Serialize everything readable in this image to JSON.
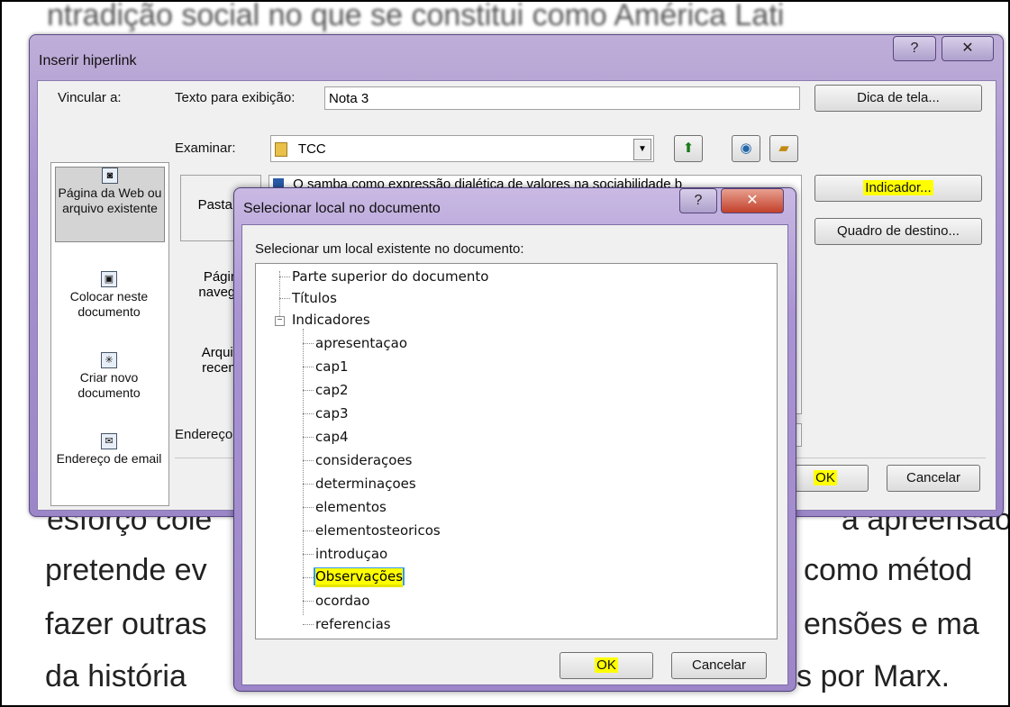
{
  "background_document": {
    "lines": [
      "pretende ev",
      "como métod",
      "fazer outras",
      "ensões e ma",
      "da história",
      "s por Marx.",
      "esforço cole",
      "a apreensão"
    ]
  },
  "hyperlink_dialog": {
    "title": "Inserir hiperlink",
    "help_btn": "?",
    "close_btn": "✕",
    "link_to_label": "Vincular a:",
    "display_text_label": "Texto para exibição:",
    "display_text_value": "Nota 3",
    "screen_tip_btn": "Dica de tela...",
    "browse_label": "Examinar:",
    "browse_value": "TCC",
    "file_list_first": "O samba como expressão dialética de valores na sociabilidade b",
    "bookmark_btn": "Indicador...",
    "target_frame_btn": "Quadro de destino...",
    "address_label": "Endereço",
    "ok_btn": "OK",
    "cancel_btn": "Cancelar",
    "link_items": [
      {
        "label": "Página da Web ou arquivo existente",
        "icon": "web-page-icon"
      },
      {
        "label": "Colocar neste documento",
        "icon": "place-in-document-icon"
      },
      {
        "label": "Criar novo documento",
        "icon": "new-document-icon"
      },
      {
        "label": "Endereço de email",
        "icon": "email-icon"
      }
    ],
    "side_buttons": [
      "Pasta a",
      "Págin navega",
      "Arquiv recent"
    ]
  },
  "select_place_dialog": {
    "title": "Selecionar local no documento",
    "help_btn": "?",
    "close_btn": "✕",
    "prompt": "Selecionar um local existente no documento:",
    "top_items": [
      "Parte superior do documento",
      "Títulos"
    ],
    "bookmarks_label": "Indicadores",
    "expander": "−",
    "bookmarks": [
      "apresentaçao",
      "cap1",
      "cap2",
      "cap3",
      "cap4",
      "consideraçoes",
      "determinaçoes",
      "elementos",
      "elementosteoricos",
      "introduçao",
      "Observações",
      "ocordao",
      "referencias"
    ],
    "selected_bookmark": "Observações",
    "ok_btn": "OK",
    "cancel_btn": "Cancelar"
  }
}
